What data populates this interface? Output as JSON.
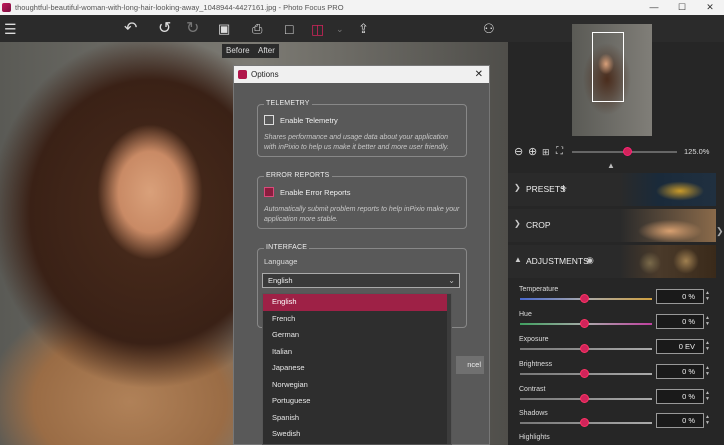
{
  "window": {
    "title": "thoughtful-beautiful-woman-with-long-hair-looking-away_1048944-4427161.jpg - Photo Focus PRO",
    "controls": [
      "—",
      "☐",
      "✕"
    ]
  },
  "toolbar": {
    "tooltip_before": "Before",
    "tooltip_after": "After"
  },
  "dialog": {
    "title": "Options",
    "close": "✕",
    "telemetry": {
      "legend": "TELEMETRY",
      "checkbox_label": "Enable Telemetry",
      "description": "Shares performance and usage data about your application with inPixio to help us make it better and more user friendly."
    },
    "error_reports": {
      "legend": "ERROR REPORTS",
      "checkbox_label": "Enable Error Reports",
      "description": "Automatically submit problem reports to help inPixio make your application more stable."
    },
    "interface": {
      "legend": "INTERFACE",
      "language_label": "Language",
      "language_value": "English"
    },
    "cancel_label": "ncel"
  },
  "language_options": [
    "English",
    "French",
    "German",
    "Italian",
    "Japanese",
    "Norwegian",
    "Portuguese",
    "Spanish",
    "Swedish"
  ],
  "navigator": {
    "zoom_value": "125.0%"
  },
  "sections": {
    "presets": "PRESETS",
    "crop": "CROP",
    "adjustments": "ADJUSTMENTS"
  },
  "adjustments": [
    {
      "label": "Temperature",
      "value": "0 %"
    },
    {
      "label": "Hue",
      "value": "0 %"
    },
    {
      "label": "Exposure",
      "value": "0 EV"
    },
    {
      "label": "Brightness",
      "value": "0 %"
    },
    {
      "label": "Contrast",
      "value": "0 %"
    },
    {
      "label": "Shadows",
      "value": "0 %"
    },
    {
      "label": "Highlights",
      "value": ""
    }
  ]
}
